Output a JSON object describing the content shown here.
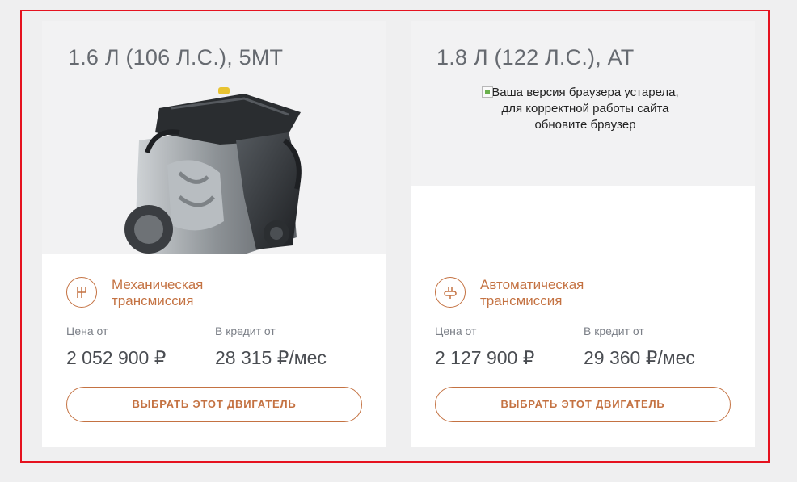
{
  "colors": {
    "accent": "#c47242",
    "highlight_border": "#e5121f"
  },
  "engines": [
    {
      "title": "1.6 Л (106 Л.С.), 5МТ",
      "image": "engine-image",
      "transmission_icon": "manual-gearbox-icon",
      "transmission": "Механическая трансмиссия",
      "price_label": "Цена от",
      "price": "2 052 900 ₽",
      "credit_label": "В кредит от",
      "credit": "28 315 ₽/мес",
      "button": "ВЫБРАТЬ ЭТОТ ДВИГАТЕЛЬ"
    },
    {
      "title": "1.8 Л (122 Л.С.), АТ",
      "image_alt": "Ваша версия браузера устарела, для корректной работы сайта обновите браузер",
      "transmission_icon": "automatic-gearbox-icon",
      "transmission": "Автоматическая трансмиссия",
      "price_label": "Цена от",
      "price": "2 127 900 ₽",
      "credit_label": "В кредит от",
      "credit": "29 360 ₽/мес",
      "button": "ВЫБРАТЬ ЭТОТ ДВИГАТЕЛЬ"
    }
  ]
}
